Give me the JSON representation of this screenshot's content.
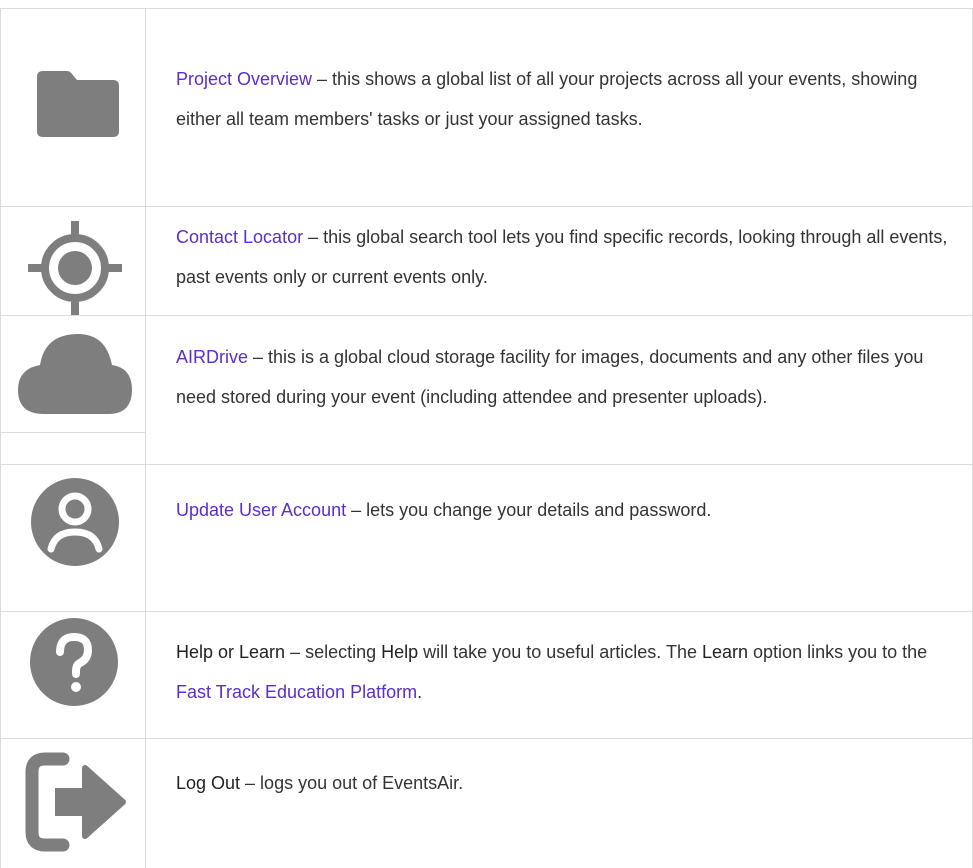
{
  "colors": {
    "link": "#5a2dcc",
    "icon": "#7e7e7e",
    "text": "#333333",
    "border": "#dcdcdc"
  },
  "rows": [
    {
      "icon": "folder-icon",
      "title": "Project Overview",
      "description": " – this shows a global list of all your projects across all your events, showing either all team members' tasks or just your assigned tasks."
    },
    {
      "icon": "crosshair-icon",
      "title": "Contact Locator",
      "description": " – this global search tool lets you find specific records, looking through all events, past events only or current events only."
    },
    {
      "icon": "cloud-icon",
      "title": "AIRDrive",
      "description": " – this is a global cloud storage facility for images, documents and any other files you need stored during your event (including attendee and presenter uploads)."
    },
    {
      "icon": "user-account-icon",
      "title": "Update User Account",
      "description": " – lets you change your details and password."
    },
    {
      "icon": "help-icon",
      "title": "Help or Learn",
      "part1": " – selecting ",
      "help": "Help",
      "part2": " will take you to useful articles. The ",
      "learn": "Learn",
      "part3": " option links you to the ",
      "link": "Fast Track Education Platform",
      "part4": "."
    },
    {
      "icon": "logout-icon",
      "title": "Log Out",
      "description": " – logs you out of EventsAir."
    }
  ]
}
